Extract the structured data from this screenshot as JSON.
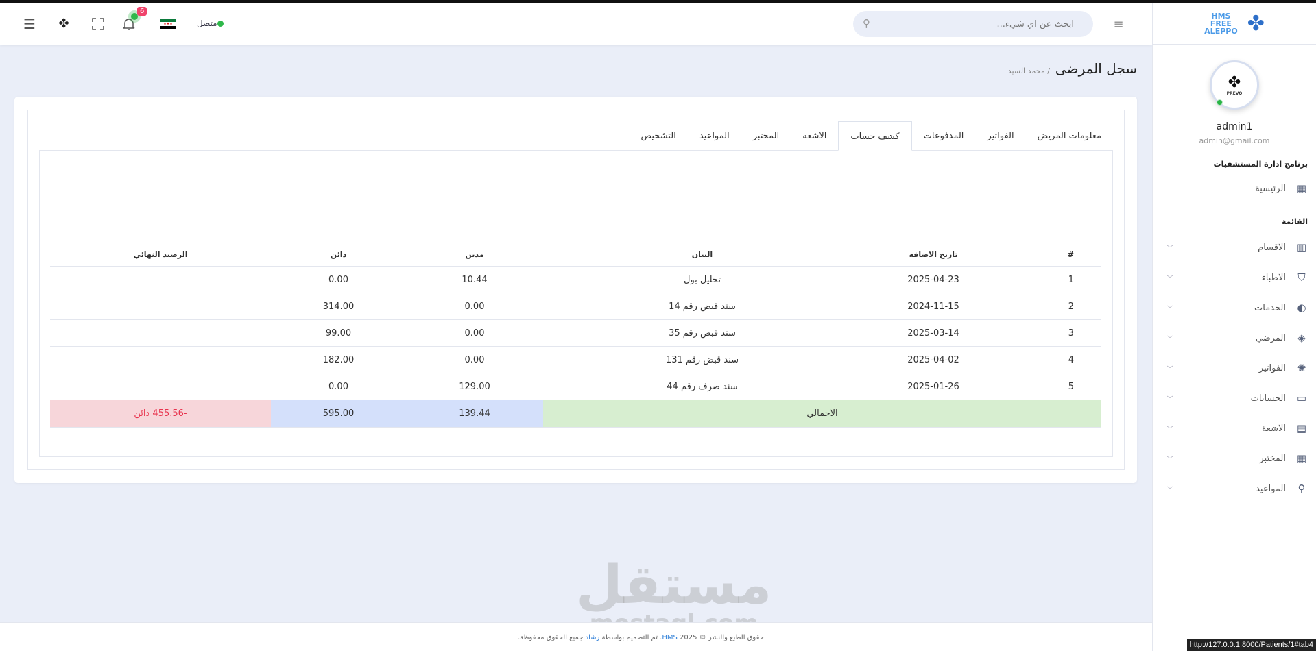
{
  "header": {
    "search_placeholder": "ابحث عن اي شيء...",
    "notification_count": "6",
    "status_label": "متصل"
  },
  "sidebar": {
    "logo_text": [
      "HMS",
      "FREE",
      "ALEPPO"
    ],
    "avatar_text": "PREVO",
    "user_name": "admin1",
    "user_email": "admin@gmail.com",
    "section_title": "برنامج ادارة المستشفيات",
    "home": "الرئيسية",
    "menu_title": "القائمة",
    "items": [
      {
        "label": "الاقسام",
        "icon": "chart-bar-icon"
      },
      {
        "label": "الاطباء",
        "icon": "basket-icon"
      },
      {
        "label": "الخدمات",
        "icon": "contrast-icon"
      },
      {
        "label": "المرضي",
        "icon": "layers-icon"
      },
      {
        "label": "الفواتير",
        "icon": "palette-icon"
      },
      {
        "label": "الحسابات",
        "icon": "chat-icon"
      },
      {
        "label": "الاشعة",
        "icon": "file-icon"
      },
      {
        "label": "المختبر",
        "icon": "table-icon"
      },
      {
        "label": "المواعيد",
        "icon": "map-pin-icon"
      }
    ]
  },
  "page": {
    "title": "سجل المرضى",
    "breadcrumb": "/ محمد السيد"
  },
  "tabs": [
    {
      "label": "معلومات المريض"
    },
    {
      "label": "الفواتير"
    },
    {
      "label": "المدفوعات"
    },
    {
      "label": "كشف حساب",
      "active": true
    },
    {
      "label": "الاشعه"
    },
    {
      "label": "المختبر"
    },
    {
      "label": "المواعيد"
    },
    {
      "label": "التشخيص"
    }
  ],
  "table": {
    "headers": [
      "#",
      "تاريخ الاضافه",
      "البيان",
      "مدين",
      "دائن",
      "الرصيد النهائي"
    ],
    "rows": [
      [
        "1",
        "2025-04-23",
        "تحليل بول",
        "10.44",
        "0.00",
        ""
      ],
      [
        "2",
        "2024-11-15",
        "سند قبض رقم 14",
        "0.00",
        "314.00",
        ""
      ],
      [
        "3",
        "2025-03-14",
        "سند قبض رقم 35",
        "0.00",
        "99.00",
        ""
      ],
      [
        "4",
        "2025-04-02",
        "سند قبض رقم 131",
        "0.00",
        "182.00",
        ""
      ],
      [
        "5",
        "2025-01-26",
        "سند صرف رقم 44",
        "129.00",
        "0.00",
        ""
      ]
    ],
    "total": {
      "label": "الاجمالي",
      "debit": "139.44",
      "credit": "595.00",
      "balance": "-455.56 دائن"
    }
  },
  "footer": {
    "text_before": "حقوق الطبع والنشر © 2025 ",
    "brand": "HMS",
    "text_mid": ". تم التصميم بواسطة ",
    "author": "رشاد",
    "text_after": " جميع الحقوق محفوظة."
  },
  "watermark": {
    "arabic": "مستقل",
    "latin": "mostaql.com"
  },
  "status_url": "http://127.0.0.1:8000/Patients/1#tab4"
}
